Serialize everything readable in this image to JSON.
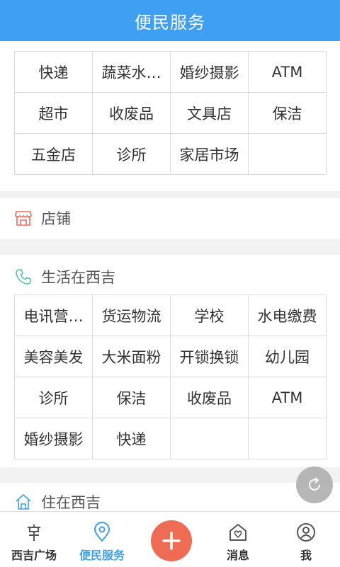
{
  "header": {
    "title": "便民服务"
  },
  "services": {
    "cells": [
      "快递",
      "蔬菜水…",
      "婚纱摄影",
      "ATM",
      "超市",
      "收废品",
      "文具店",
      "保洁",
      "五金店",
      "诊所",
      "家居市场",
      ""
    ]
  },
  "shops": {
    "title": "店铺",
    "icon": "shop-icon"
  },
  "life": {
    "title": "生活在西吉",
    "icon": "phone-icon",
    "cells": [
      "电讯营…",
      "货运物流",
      "学校",
      "水电缴费",
      "美容美发",
      "大米面粉",
      "开锁换锁",
      "幼儿园",
      "诊所",
      "保洁",
      "收废品",
      "ATM",
      "婚纱摄影",
      "快递",
      "",
      ""
    ]
  },
  "live": {
    "title": "住在西吉",
    "icon": "house-icon"
  },
  "tabbar": {
    "items": [
      {
        "label": "西吉广场",
        "icon": "plaza-icon"
      },
      {
        "label": "便民服务",
        "icon": "location-pin-icon"
      },
      {
        "label": "",
        "icon": "plus-icon"
      },
      {
        "label": "消息",
        "icon": "message-icon"
      },
      {
        "label": "我",
        "icon": "user-icon"
      }
    ]
  },
  "colors": {
    "primary": "#3f9ff2",
    "accent": "#ee6b54",
    "shop_icon": "#ee6b54",
    "phone_icon": "#4fc8a6",
    "house_icon": "#3f9ff2"
  }
}
